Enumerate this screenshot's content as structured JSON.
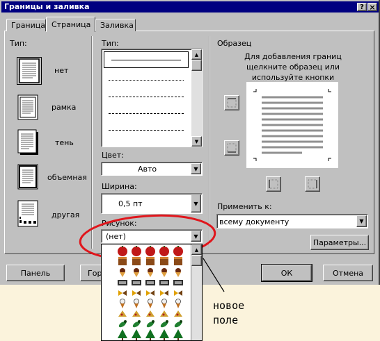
{
  "window": {
    "title": "Границы и заливка",
    "help_label": "?",
    "close_label": "×"
  },
  "tabs": [
    {
      "label": "Граница",
      "active": false
    },
    {
      "label": "Страница",
      "active": true
    },
    {
      "label": "Заливка",
      "active": false
    }
  ],
  "type_section": {
    "label": "Тип:",
    "options": [
      {
        "label": "нет",
        "icon": "page-none-icon"
      },
      {
        "label": "рамка",
        "icon": "page-box-icon"
      },
      {
        "label": "тень",
        "icon": "page-shadow-icon"
      },
      {
        "label": "объемная",
        "icon": "page-3d-icon"
      },
      {
        "label": "другая",
        "icon": "page-custom-icon"
      }
    ]
  },
  "style_section": {
    "label": "Тип:",
    "color_label": "Цвет:",
    "color_value": "Авто",
    "width_label": "Ширина:",
    "width_value": "0,5 пт",
    "art_label": "Рисунок:",
    "art_value": "(нет)"
  },
  "preview_section": {
    "label": "Образец",
    "hint": "Для добавления границ щелкните образец или используйте кнопки",
    "apply_label": "Применить к:",
    "apply_value": "всему документу",
    "options_button": "Параметры..."
  },
  "footer": {
    "panel_button": "Панель",
    "horizontal_button": "Гор",
    "ok_button": "ОК",
    "cancel_button": "Отмена"
  },
  "annotation": {
    "line1": "новое",
    "line2": "поле"
  },
  "colors": {
    "dialog": "#c0c0c0",
    "title_bar": "#000080",
    "highlight_circle": "#e0161c",
    "annotation_bg": "#fbf3dc"
  },
  "art_rows": [
    "apples",
    "cakes",
    "ice-cream-cones",
    "candy-boxes",
    "bows",
    "cones",
    "slices",
    "lizards",
    "christmas-trees"
  ]
}
